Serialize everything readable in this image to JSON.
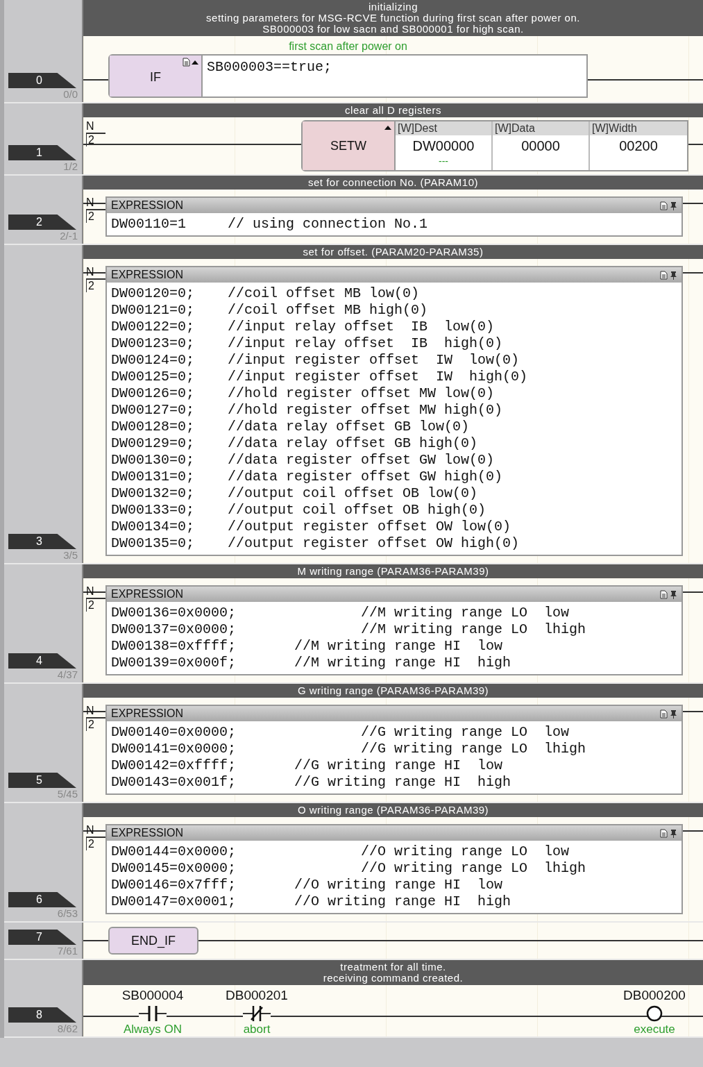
{
  "rungs": [
    {
      "number": "0",
      "step": "0/0",
      "comment": [
        "initializing",
        "setting parameters for MSG-RCVE function during first scan after power on.",
        "SB000003 for low sacn and SB000001 for high scan."
      ],
      "kind": "if",
      "annotation": "first scan after power on",
      "keyword": "IF",
      "condition": "SB000003==true;"
    },
    {
      "number": "1",
      "step": "1/2",
      "comment": [
        "clear all D registers"
      ],
      "kind": "setw",
      "n_label": "N",
      "n_value": "2",
      "keyword": "SETW",
      "columns": [
        {
          "header": "[W]Dest",
          "value": "DW00000",
          "annotation": "---"
        },
        {
          "header": "[W]Data",
          "value": "00000"
        },
        {
          "header": "[W]Width",
          "value": "00200"
        }
      ]
    },
    {
      "number": "2",
      "step": "2/-1",
      "comment": [
        "set for connection No. (PARAM10)"
      ],
      "kind": "expression",
      "n_label": "N",
      "n_value": "2",
      "title": "EXPRESSION",
      "lines": [
        "DW00110=1     // using connection No.1"
      ]
    },
    {
      "number": "3",
      "step": "3/5",
      "comment": [
        "set for offset. (PARAM20-PARAM35)"
      ],
      "kind": "expression",
      "n_label": "N",
      "n_value": "2",
      "title": "EXPRESSION",
      "lines": [
        "DW00120=0;    //coil offset MB low(0)",
        "DW00121=0;    //coil offset MB high(0)",
        "DW00122=0;    //input relay offset  IB  low(0)",
        "DW00123=0;    //input relay offset  IB  high(0)",
        "DW00124=0;    //input register offset  IW  low(0)",
        "DW00125=0;    //input register offset  IW  high(0)",
        "DW00126=0;    //hold register offset MW low(0)",
        "DW00127=0;    //hold register offset MW high(0)",
        "DW00128=0;    //data relay offset GB low(0)",
        "DW00129=0;    //data relay offset GB high(0)",
        "DW00130=0;    //data register offset GW low(0)",
        "DW00131=0;    //data register offset GW high(0)",
        "DW00132=0;    //output coil offset OB low(0)",
        "DW00133=0;    //output coil offset OB high(0)",
        "DW00134=0;    //output register offset OW low(0)",
        "DW00135=0;    //output register offset OW high(0)"
      ]
    },
    {
      "number": "4",
      "step": "4/37",
      "comment": [
        "M writing range (PARAM36-PARAM39)"
      ],
      "kind": "expression",
      "n_label": "N",
      "n_value": "2",
      "title": "EXPRESSION",
      "lines": [
        "DW00136=0x0000;               //M writing range LO  low",
        "DW00137=0x0000;               //M writing range LO  lhigh",
        "DW00138=0xffff;       //M writing range HI  low",
        "DW00139=0x000f;       //M writing range HI  high"
      ]
    },
    {
      "number": "5",
      "step": "5/45",
      "comment": [
        "G writing range (PARAM36-PARAM39)"
      ],
      "kind": "expression",
      "n_label": "N",
      "n_value": "2",
      "title": "EXPRESSION",
      "lines": [
        "DW00140=0x0000;               //G writing range LO  low",
        "DW00141=0x0000;               //G writing range LO  lhigh",
        "DW00142=0xffff;       //G writing range HI  low",
        "DW00143=0x001f;       //G writing range HI  high"
      ]
    },
    {
      "number": "6",
      "step": "6/53",
      "comment": [
        "O writing range (PARAM36-PARAM39)"
      ],
      "kind": "expression",
      "n_label": "N",
      "n_value": "2",
      "title": "EXPRESSION",
      "lines": [
        "DW00144=0x0000;               //O writing range LO  low",
        "DW00145=0x0000;               //O writing range LO  lhigh",
        "DW00146=0x7fff;       //O writing range HI  low",
        "DW00147=0x0001;       //O writing range HI  high"
      ]
    },
    {
      "number": "7",
      "step": "7/61",
      "kind": "end_if",
      "keyword": "END_IF"
    },
    {
      "number": "8",
      "step": "8/62",
      "comment": [
        "treatment for all time.",
        "receiving command created."
      ],
      "kind": "contacts",
      "elements": [
        {
          "kind": "no_contact",
          "address": "SB000004",
          "annotation": "Always ON"
        },
        {
          "kind": "nc_contact",
          "address": "DB000201",
          "annotation": "abort"
        },
        {
          "kind": "coil",
          "address": "DB000200",
          "annotation": "execute"
        }
      ]
    }
  ]
}
